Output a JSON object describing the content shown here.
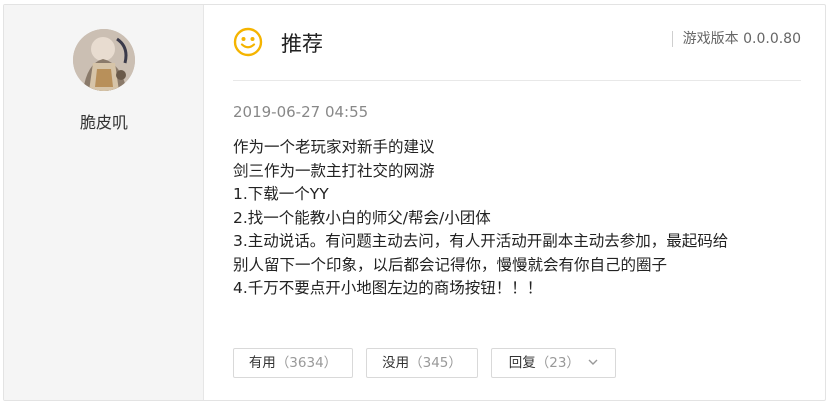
{
  "user": {
    "name": "脆皮叽"
  },
  "header": {
    "title": "推荐",
    "version": "游戏版本 0.0.0.80"
  },
  "review": {
    "date": "2019-06-27 04:55",
    "lines": [
      "作为一个老玩家对新手的建议",
      "剑三作为一款主打社交的网游",
      "1.下载一个YY",
      "2.找一个能教小白的师父/帮会/小团体",
      "3.主动说话。有问题主动去问，有人开活动开副本主动去参加，最起码给",
      "别人留下一个印象，以后都会记得你，慢慢就会有你自己的圈子",
      "4.千万不要点开小地图左边的商场按钮！！！"
    ]
  },
  "actions": {
    "useful_label": "有用",
    "useful_count": "（3634）",
    "useless_label": "没用",
    "useless_count": "（345）",
    "reply_label": "回复",
    "reply_count": "（23）"
  },
  "icons": {
    "recommend": "smiley-face-icon",
    "expand": "chevron-down-icon"
  },
  "colors": {
    "accent_yellow": "#f5b400",
    "sidebar_bg": "#f5f5f5",
    "muted_text": "#888888"
  }
}
